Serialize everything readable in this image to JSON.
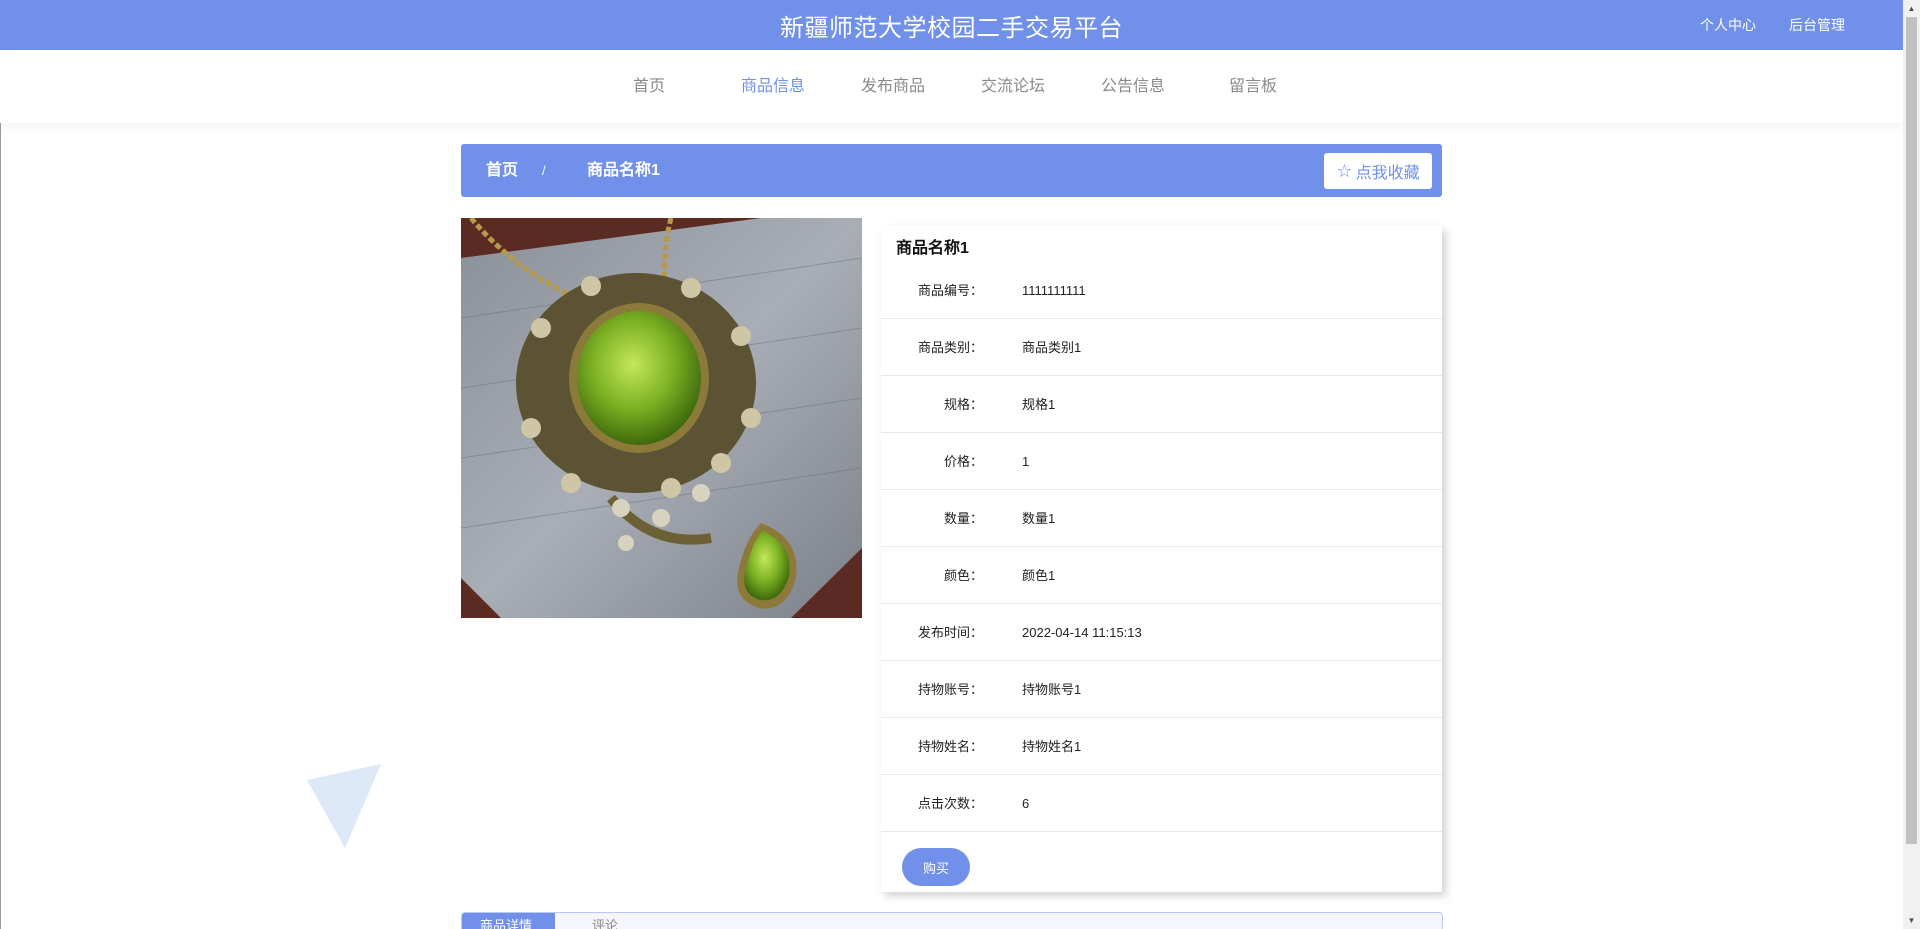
{
  "header": {
    "site_title": "新疆师范大学校园二手交易平台",
    "links": [
      "个人中心",
      "后台管理"
    ]
  },
  "nav": {
    "items": [
      "首页",
      "商品信息",
      "发布商品",
      "交流论坛",
      "公告信息",
      "留言板"
    ],
    "active": "商品信息"
  },
  "breadcrumb": {
    "home": "首页",
    "separator": "/",
    "current": "商品名称1",
    "favorite_label": "点我收藏"
  },
  "product": {
    "image_icon": "pendant-product-image",
    "name": "商品名称1",
    "fields": [
      {
        "label": "商品编号：",
        "value": "1111111111"
      },
      {
        "label": "商品类别：",
        "value": "商品类别1"
      },
      {
        "label": "规格：",
        "value": "规格1"
      },
      {
        "label": "价格：",
        "value": "1"
      },
      {
        "label": "数量：",
        "value": "数量1"
      },
      {
        "label": "颜色：",
        "value": "颜色1"
      },
      {
        "label": "发布时间：",
        "value": "2022-04-14 11:15:13"
      },
      {
        "label": "持物账号：",
        "value": "持物账号1"
      },
      {
        "label": "持物姓名：",
        "value": "持物姓名1"
      },
      {
        "label": "点击次数：",
        "value": "6"
      }
    ],
    "buy_label": "购买"
  },
  "tabs": {
    "items": [
      "商品详情",
      "评论"
    ]
  },
  "colors": {
    "accent": "#7190e9",
    "nav_inactive": "#8a8a8a"
  }
}
